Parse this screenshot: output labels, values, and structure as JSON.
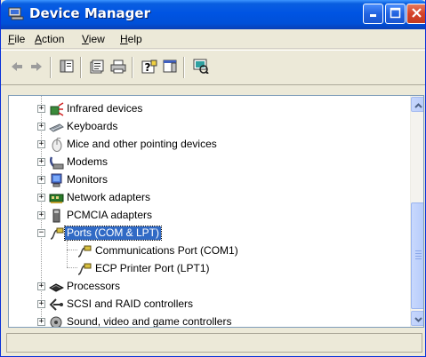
{
  "window": {
    "title": "Device Manager",
    "title_icon": "device-manager-icon"
  },
  "menu": {
    "items": [
      {
        "label": "File",
        "accel": "F",
        "rest": "ile"
      },
      {
        "label": "Action",
        "accel": "A",
        "rest": "ction"
      },
      {
        "label": "View",
        "accel": "V",
        "rest": "iew"
      },
      {
        "label": "Help",
        "accel": "H",
        "rest": "elp"
      }
    ]
  },
  "toolbar": {
    "buttons": [
      "back-icon",
      "forward-icon",
      "show-hide-console-tree-icon",
      "properties-icon",
      "print-icon",
      "help-icon",
      "show-hide-action-pane-icon",
      "scan-hardware-icon"
    ]
  },
  "tree": {
    "items": [
      {
        "label": "Infrared devices",
        "icon": "infrared-icon",
        "expander": "+",
        "level": 0
      },
      {
        "label": "Keyboards",
        "icon": "keyboard-icon",
        "expander": "+",
        "level": 0
      },
      {
        "label": "Mice and other pointing devices",
        "icon": "mouse-icon",
        "expander": "+",
        "level": 0
      },
      {
        "label": "Modems",
        "icon": "modem-icon",
        "expander": "+",
        "level": 0
      },
      {
        "label": "Monitors",
        "icon": "monitor-icon",
        "expander": "+",
        "level": 0
      },
      {
        "label": "Network adapters",
        "icon": "network-adapter-icon",
        "expander": "+",
        "level": 0
      },
      {
        "label": "PCMCIA adapters",
        "icon": "pcmcia-icon",
        "expander": "+",
        "level": 0
      },
      {
        "label": "Ports (COM & LPT)",
        "icon": "port-icon",
        "expander": "−",
        "level": 0,
        "selected": true
      },
      {
        "label": "Communications Port (COM1)",
        "icon": "port-icon",
        "expander": "",
        "level": 1
      },
      {
        "label": "ECP Printer Port (LPT1)",
        "icon": "port-icon",
        "expander": "",
        "level": 1
      },
      {
        "label": "Processors",
        "icon": "processor-icon",
        "expander": "+",
        "level": 0
      },
      {
        "label": "SCSI and RAID controllers",
        "icon": "scsi-icon",
        "expander": "+",
        "level": 0
      },
      {
        "label": "Sound, video and game controllers",
        "icon": "sound-icon",
        "expander": "+",
        "level": 0
      }
    ]
  },
  "colors": {
    "titlebar": "#0054e3",
    "selection": "#316ac5",
    "chrome": "#ece9d8"
  }
}
